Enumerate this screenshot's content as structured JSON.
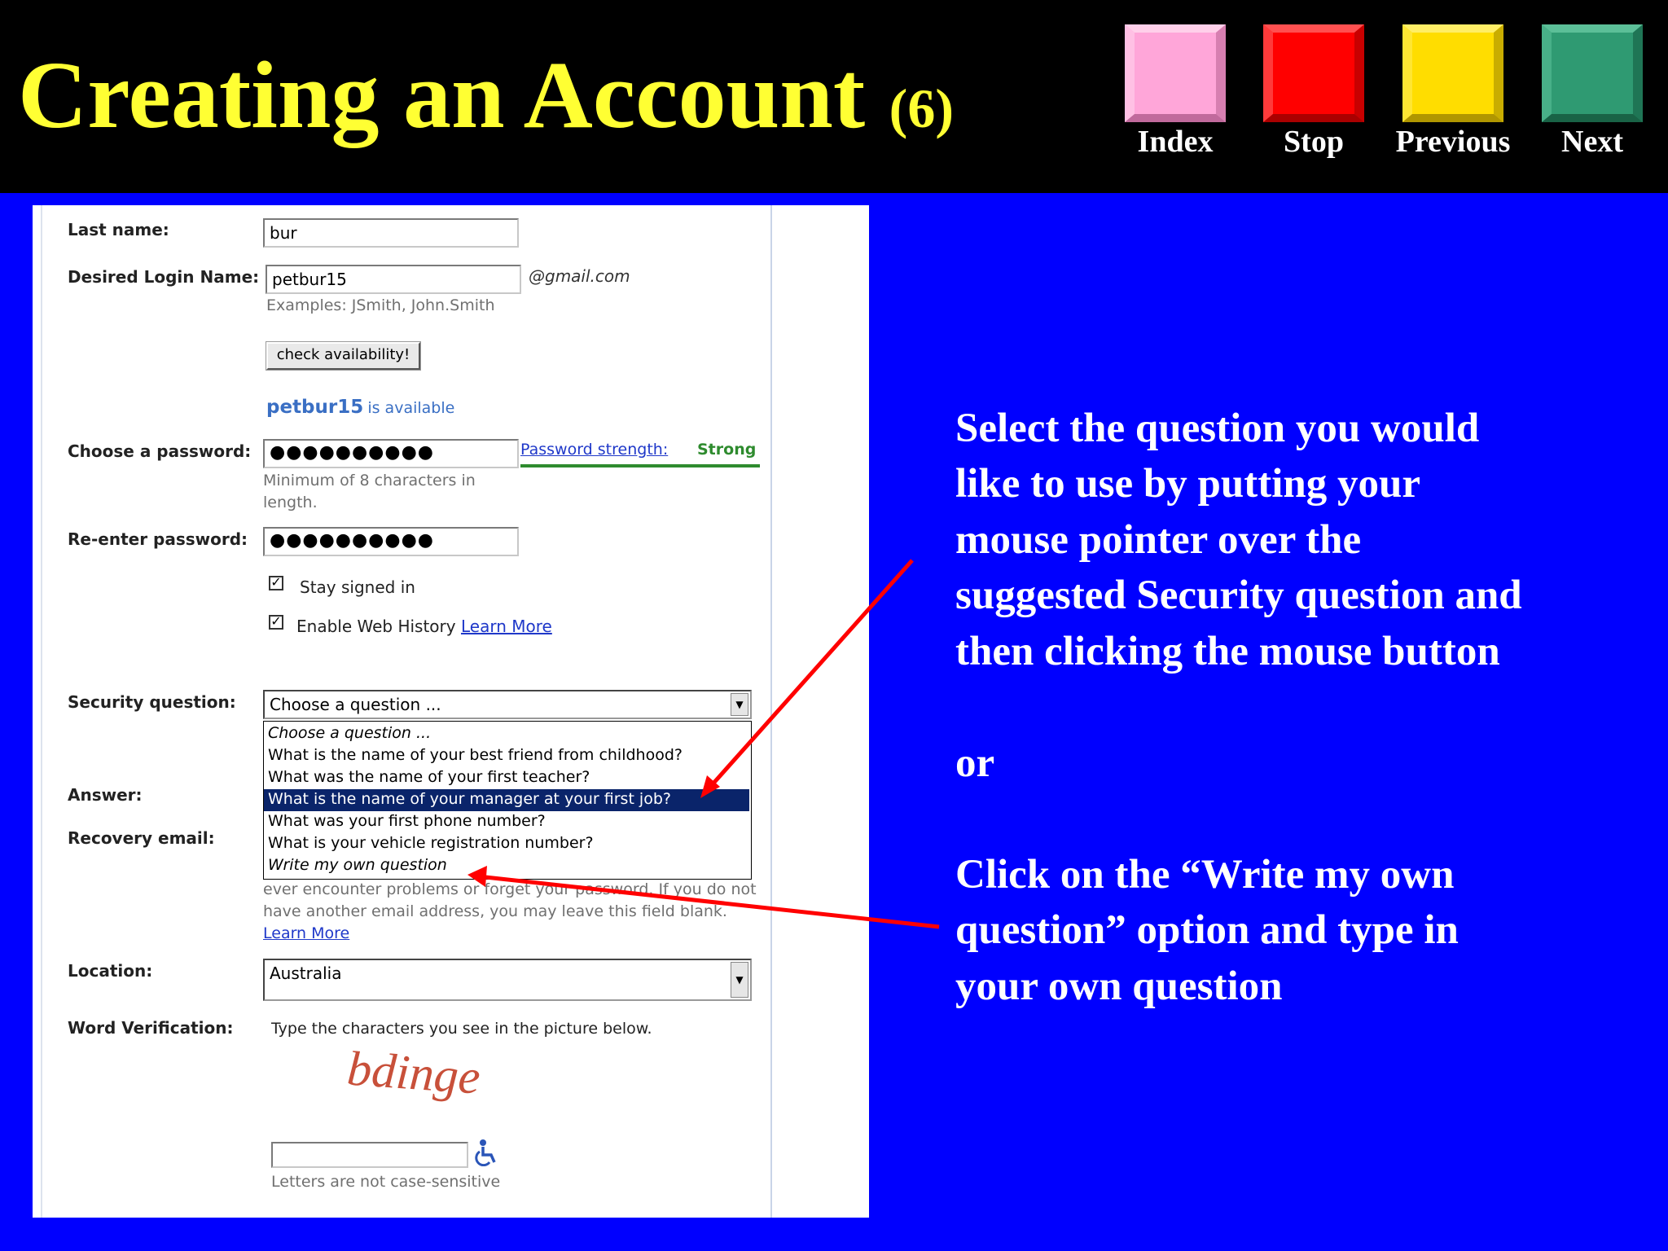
{
  "slide": {
    "title": "Creating an Account",
    "title_num": "(6)"
  },
  "nav": {
    "index": {
      "label": "Index",
      "color": "#ffa6d9"
    },
    "stop": {
      "label": "Stop",
      "color": "#ff0000"
    },
    "previous": {
      "label": "Previous",
      "color": "#ffdd00"
    },
    "next": {
      "label": "Next",
      "color": "#2f9a72"
    }
  },
  "form": {
    "last_name": {
      "label": "Last name:",
      "value": "bur"
    },
    "login": {
      "label": "Desired Login Name:",
      "value": "petbur15",
      "domain": "@gmail.com",
      "examples": "Examples: JSmith, John.Smith",
      "check_button": "check availability!",
      "avail_name": "petbur15",
      "avail_text": "is available"
    },
    "password": {
      "label": "Choose a password:",
      "value": "●●●●●●●●●●",
      "strength_label": "Password strength:",
      "strength_value": "Strong",
      "hint_line1": "Minimum of 8 characters in",
      "hint_line2": "length."
    },
    "reenter": {
      "label": "Re-enter password:",
      "value": "●●●●●●●●●●"
    },
    "stay_signed_in": {
      "label": "Stay signed in",
      "checked": true
    },
    "web_history": {
      "label": "Enable Web History",
      "link": "Learn More",
      "checked": true
    },
    "security": {
      "label": "Security question:",
      "selected": "Choose a question ...",
      "options": [
        "Choose a question ...",
        "What is the name of your best friend from childhood?",
        "What was the name of your first teacher?",
        "What is the name of your manager at your first job?",
        "What was your first phone number?",
        "What is your vehicle registration number?",
        "Write my own question"
      ],
      "highlighted_index": 3,
      "behind_fragment": "our"
    },
    "answer": {
      "label": "Answer:"
    },
    "recovery": {
      "label": "Recovery email:",
      "fragment_you": "you",
      "line2": "ever encounter problems or forget your password. If you do not",
      "line3": "have another email address, you may leave this field blank.",
      "link": "Learn More"
    },
    "location": {
      "label": "Location:",
      "value": "Australia"
    },
    "word_verification": {
      "label": "Word Verification:",
      "instruction": "Type the characters you see in the picture below.",
      "captcha": "bdinge",
      "note": "Letters are not case-sensitive",
      "accessibility_icon": "wheelchair-icon"
    }
  },
  "instructions": {
    "lines": [
      "Select the question you would",
      "like to use by putting your",
      "mouse pointer over the",
      "suggested Security question and",
      "then clicking the mouse button"
    ],
    "or": "or",
    "lines2": [
      "Click on the “Write my own",
      "question” option and type in",
      "your own question"
    ]
  },
  "colors": {
    "background": "#0000ff",
    "title": "#ffff33",
    "arrow": "#ff0000",
    "selection": "#0a246a"
  }
}
